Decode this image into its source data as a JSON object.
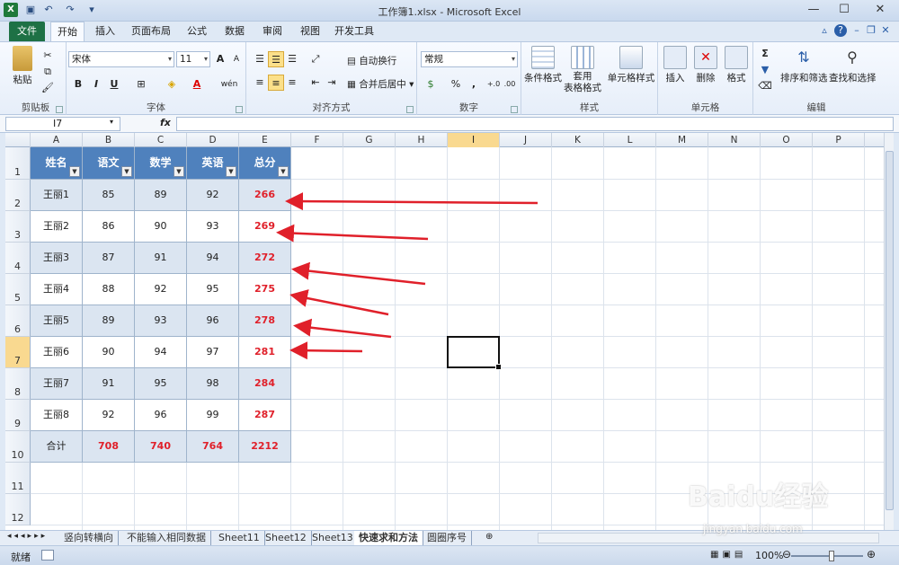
{
  "window": {
    "title": "工作簿1.xlsx - Microsoft Excel",
    "app_icon": "X"
  },
  "ribbon_tabs": [
    "文件",
    "开始",
    "插入",
    "页面布局",
    "公式",
    "数据",
    "审阅",
    "视图",
    "开发工具"
  ],
  "ribbon": {
    "clipboard": {
      "paste": "粘贴",
      "label": "剪贴板"
    },
    "font": {
      "name": "宋体",
      "size": "11",
      "bold": "B",
      "italic": "I",
      "underline": "U",
      "label": "字体",
      "grow": "A",
      "shrink": "A",
      "fontcolor": "A",
      "phonetic": "wén"
    },
    "alignment": {
      "wrap": "自动换行",
      "merge": "合并后居中",
      "label": "对齐方式"
    },
    "number": {
      "format": "常规",
      "percent": "%",
      "comma": ",",
      "label": "数字",
      "inc": "+.0",
      "dec": ".00"
    },
    "styles": {
      "cond": "条件格式",
      "table1": "套用",
      "table2": "表格格式",
      "cell": "单元格样式",
      "label": "样式"
    },
    "cells": {
      "insert": "插入",
      "delete": "删除",
      "format": "格式",
      "label": "单元格"
    },
    "editing": {
      "sort": "排序和筛选",
      "find": "查找和选择",
      "label": "编辑",
      "sigma": "Σ"
    }
  },
  "formula_bar": {
    "name_box": "I7",
    "fx": "fx",
    "value": ""
  },
  "columns": [
    "A",
    "B",
    "C",
    "D",
    "E",
    "F",
    "G",
    "H",
    "I",
    "J",
    "K",
    "L",
    "M",
    "N",
    "O",
    "P"
  ],
  "selected_column": "I",
  "selected_row": "7",
  "rows": [
    "1",
    "2",
    "3",
    "4",
    "5",
    "6",
    "7",
    "8",
    "9",
    "10",
    "11",
    "12"
  ],
  "table": {
    "headers": [
      "姓名",
      "语文",
      "数学",
      "英语",
      "总分"
    ],
    "data": [
      [
        "王丽1",
        "85",
        "89",
        "92",
        "266"
      ],
      [
        "王丽2",
        "86",
        "90",
        "93",
        "269"
      ],
      [
        "王丽3",
        "87",
        "91",
        "94",
        "272"
      ],
      [
        "王丽4",
        "88",
        "92",
        "95",
        "275"
      ],
      [
        "王丽5",
        "89",
        "93",
        "96",
        "278"
      ],
      [
        "王丽6",
        "90",
        "94",
        "97",
        "281"
      ],
      [
        "王丽7",
        "91",
        "95",
        "98",
        "284"
      ],
      [
        "王丽8",
        "92",
        "96",
        "99",
        "287"
      ]
    ],
    "total": [
      "合计",
      "708",
      "740",
      "764",
      "2212"
    ]
  },
  "sheet_tabs": [
    "竖向转横向",
    "不能输入相同数据",
    "Sheet11",
    "Sheet12",
    "Sheet13",
    "快速求和方法",
    "圆圈序号"
  ],
  "active_sheet": "快速求和方法",
  "status": {
    "ready": "就绪",
    "zoom": "100%"
  },
  "colors": {
    "header_fill": "#4f81bd",
    "band_fill": "#dbe5f1",
    "total_text": "#e0202a",
    "arrow": "#e0202a",
    "file_tab": "#1e7145"
  },
  "watermark": {
    "logo": "Baidu经验",
    "url": "jingyan.baidu.com"
  }
}
